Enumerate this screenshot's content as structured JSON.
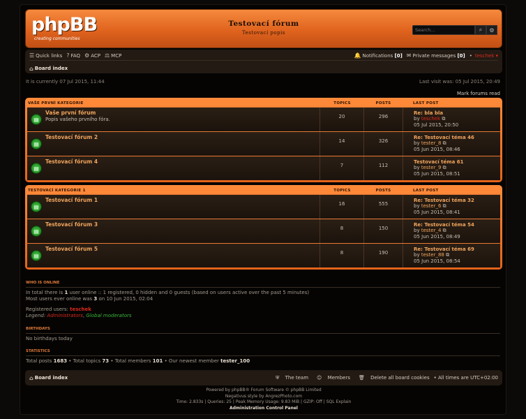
{
  "header": {
    "logo_text": "phpBB",
    "logo_sub": "creating communities",
    "logo_reg": "®",
    "site_title": "Testovací fórum",
    "site_desc": "Testovací popis",
    "search_placeholder": "Search…"
  },
  "navbar": {
    "quick_links": "Quick links",
    "faq": "FAQ",
    "acp": "ACP",
    "mcp": "MCP",
    "notifications_label": "Notifications",
    "notifications_count": "[0]",
    "pm_label": "Private messages",
    "pm_count": "[0]",
    "bullet": "•",
    "username": "teschek",
    "board_index": "Board index"
  },
  "info": {
    "current_time": "It is currently 07 Jul 2015, 11:44",
    "last_visit": "Last visit was: 05 Jul 2015, 20:49",
    "mark_read": "Mark forums read"
  },
  "categories": [
    {
      "name": "Vaše první kategorie",
      "col_topics": "Topics",
      "col_posts": "Posts",
      "col_last": "Last post",
      "forums": [
        {
          "title": "Vaše první fórum",
          "desc": "Popis vašeho prvního fóra.",
          "topics": "20",
          "posts": "296",
          "last_title": "Re: bla bla",
          "by": "by",
          "last_user": "teschek",
          "last_date": "05 Jul 2015, 20:50"
        },
        {
          "title": "Testovací fórum 2",
          "desc": "",
          "topics": "14",
          "posts": "326",
          "last_title": "Re: Testovací téma 46",
          "by": "by",
          "last_user": "tester_8",
          "last_date": "05 Jun 2015, 08:46"
        },
        {
          "title": "Testovací fórum 4",
          "desc": "",
          "topics": "7",
          "posts": "112",
          "last_title": "Testovací téma 61",
          "by": "by",
          "last_user": "tester_9",
          "last_date": "05 Jun 2015, 08:51"
        }
      ]
    },
    {
      "name": "Testovací kategorie 1",
      "col_topics": "Topics",
      "col_posts": "Posts",
      "col_last": "Last post",
      "forums": [
        {
          "title": "Testovací fórum 1",
          "desc": "",
          "topics": "16",
          "posts": "555",
          "last_title": "Re: Testovací téma 32",
          "by": "by",
          "last_user": "tester_6",
          "last_date": "05 Jun 2015, 08:41"
        },
        {
          "title": "Testovací fórum 3",
          "desc": "",
          "topics": "8",
          "posts": "150",
          "last_title": "Re: Testovací téma 54",
          "by": "by",
          "last_user": "tester_4",
          "last_date": "05 Jun 2015, 08:49"
        },
        {
          "title": "Testovací fórum 5",
          "desc": "",
          "topics": "8",
          "posts": "190",
          "last_title": "Re: Testovací téma 69",
          "by": "by",
          "last_user": "tester_88",
          "last_date": "05 Jun 2015, 08:54"
        }
      ]
    }
  ],
  "who_online": {
    "heading": "Who is online",
    "line1_a": "In total there is ",
    "line1_b": "1",
    "line1_c": " user online :: 1 registered, 0 hidden and 0 guests (based on users active over the past 5 minutes)",
    "line2_a": "Most users ever online was ",
    "line2_b": "3",
    "line2_c": " on 10 Jun 2015, 02:04",
    "registered_label": "Registered users: ",
    "registered_user": "teschek",
    "legend_label": "Legend: ",
    "legend_admin": "Administrators",
    "legend_sep": ", ",
    "legend_gmod": "Global moderators"
  },
  "birthdays": {
    "heading": "Birthdays",
    "text": "No birthdays today"
  },
  "statistics": {
    "heading": "Statistics",
    "posts_label": "Total posts ",
    "posts": "1683",
    "topics_label": " • Total topics ",
    "topics": "73",
    "members_label": " • Total members ",
    "members": "101",
    "newest_label": " • Our newest member ",
    "newest": "tester_100"
  },
  "footer": {
    "board_index": "Board index",
    "team": "The team",
    "members": "Members",
    "delete_cookies": "Delete all board cookies",
    "timezone": "• All times are UTC+02:00",
    "powered": "Powered by phpBB® Forum Software © phpBB Limited",
    "style": "Negativus style by AngrezPhoto.com",
    "stats": "Time: 2.833s | Queries: 25 | Peak Memory Usage: 9.83 MiB | GZIP: Off | SQL Explain",
    "acp": "Administration Control Panel"
  }
}
